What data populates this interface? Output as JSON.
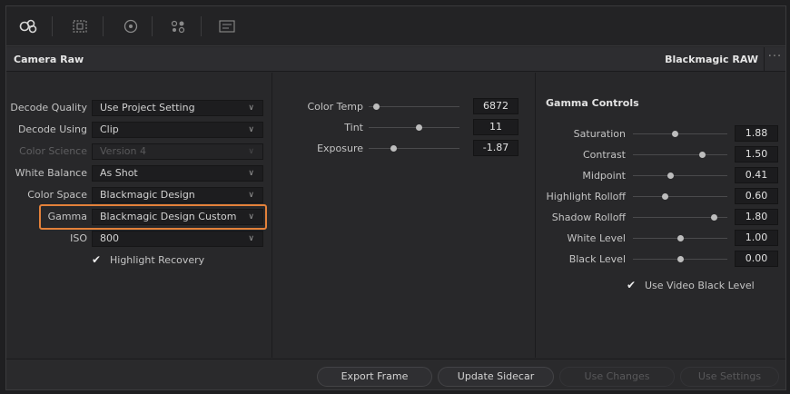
{
  "toolbar": {
    "icons": [
      "davinci-logo-icon",
      "media-pool-icon",
      "color-picker-icon",
      "nodes-icon",
      "lut-icon"
    ]
  },
  "header": {
    "title": "Camera Raw",
    "format": "Blackmagic RAW",
    "more": "···"
  },
  "decode": {
    "rows": [
      {
        "label": "Decode Quality",
        "value": "Use Project Setting",
        "enabled": true
      },
      {
        "label": "Decode Using",
        "value": "Clip",
        "enabled": true
      },
      {
        "label": "Color Science",
        "value": "Version 4",
        "enabled": false
      },
      {
        "label": "White Balance",
        "value": "As Shot",
        "enabled": true
      },
      {
        "label": "Color Space",
        "value": "Blackmagic Design",
        "enabled": true
      },
      {
        "label": "Gamma",
        "value": "Blackmagic Design Custom",
        "enabled": true
      },
      {
        "label": "ISO",
        "value": "800",
        "enabled": true
      }
    ],
    "highlight_recovery": {
      "label": "Highlight Recovery",
      "checked": true
    }
  },
  "color": {
    "sliders": [
      {
        "label": "Color Temp",
        "value": "6872",
        "position": 0.08
      },
      {
        "label": "Tint",
        "value": "11",
        "position": 0.55
      },
      {
        "label": "Exposure",
        "value": "-1.87",
        "position": 0.27
      }
    ]
  },
  "gamma": {
    "title": "Gamma Controls",
    "sliders": [
      {
        "label": "Saturation",
        "value": "1.88",
        "position": 0.44
      },
      {
        "label": "Contrast",
        "value": "1.50",
        "position": 0.73
      },
      {
        "label": "Midpoint",
        "value": "0.41",
        "position": 0.39
      },
      {
        "label": "Highlight Rolloff",
        "value": "0.60",
        "position": 0.34
      },
      {
        "label": "Shadow Rolloff",
        "value": "1.80",
        "position": 0.86
      },
      {
        "label": "White Level",
        "value": "1.00",
        "position": 0.5
      },
      {
        "label": "Black Level",
        "value": "0.00",
        "position": 0.5
      }
    ],
    "use_video_black": {
      "label": "Use Video Black Level",
      "checked": true
    }
  },
  "footer": {
    "export_frame": "Export Frame",
    "update_sidecar": "Update Sidecar",
    "use_changes": "Use Changes",
    "use_settings": "Use Settings"
  },
  "colors": {
    "accent_highlight": "#e3813a"
  }
}
